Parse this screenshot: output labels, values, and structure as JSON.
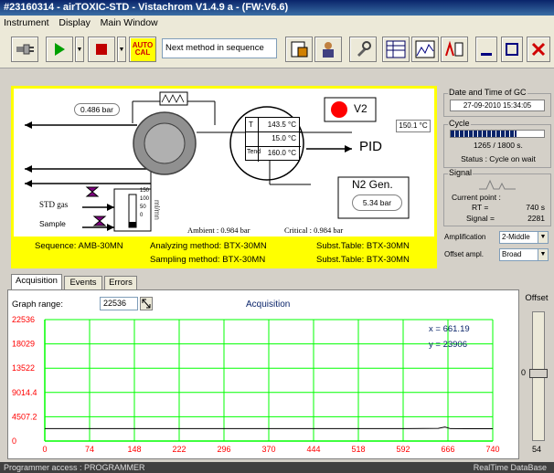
{
  "window": {
    "title": "#23160314 - airTOXIC-STD - Vistachrom V1.4.9 a - (FW:V6.6)"
  },
  "menu": [
    {
      "label": "Instrument"
    },
    {
      "label": "Display"
    },
    {
      "label": "Main Window"
    }
  ],
  "toolbar": {
    "autocal_label": "AUTO\nCAL",
    "method_value": "Next method in sequence"
  },
  "diagram": {
    "pressure_top": "0.486 bar",
    "v2_label": "V2",
    "temp_t_label": "T",
    "temp_t_value": "143.5 °C",
    "temp_2_value": "15.0 °C",
    "temp_tend_label": "Tend",
    "temp_tend_value": "160.0 °C",
    "pid_temp": "150.1 °C",
    "pid_label": "PID",
    "n2_label": "N2 Gen.",
    "n2_value": "5.34 bar",
    "std_gas_label": "STD gas",
    "sample_label": "Sample",
    "flow_unit": "ml/mn",
    "flow_scale": [
      "150",
      "100",
      "50",
      "0"
    ],
    "ambient_text": "Ambient : 0.984 bar",
    "critical_text": "Critical : 0.984 bar"
  },
  "info": {
    "sequence": "Sequence: AMB-30MN",
    "analyzing": "Analyzing method: BTX-30MN",
    "subst_1": "Subst.Table: BTX-30MN",
    "sampling": "Sampling method: BTX-30MN",
    "subst_2": "Subst.Table: BTX-30MN"
  },
  "right_panel": {
    "date_title": "Date and Time of GC",
    "date_value": "27-09-2010 15:34:05",
    "cycle_title": "Cycle",
    "cycle_value": "1265 / 1800 s.",
    "cycle_progress": 0.703,
    "status_text": "Status : Cycle on wait",
    "signal_title": "Signal",
    "current_point_label": "Current point :",
    "rt_label": "RT =",
    "rt_value": "740 s",
    "signal_label": "Signal =",
    "signal_value": "2281",
    "amplification_label": "Amplification",
    "amplification_value": "2-Middle",
    "offset_ampl_label": "Offset ampl.",
    "offset_ampl_value": "Broad"
  },
  "tabs": [
    {
      "label": "Acquisition"
    },
    {
      "label": "Events"
    },
    {
      "label": "Errors"
    }
  ],
  "acquisition": {
    "graph_range_label": "Graph range:",
    "graph_range_value": "22536",
    "title": "Acquisition",
    "cursor_x": "x = 661.19",
    "cursor_y": "y = 23906"
  },
  "offset_panel": {
    "title": "Offset",
    "value": "0",
    "bottom_value": "54"
  },
  "status": {
    "left": "Programmer access : PROGRAMMER",
    "right": "RealTime DataBase"
  },
  "colors": {
    "panel_yellow": "#ffff00",
    "grid_green": "#00ff00",
    "axis_red": "#ff0000",
    "title_blue": "#0a246a"
  },
  "chart_data": {
    "type": "line",
    "title": "Acquisition",
    "xlim": [
      0,
      740
    ],
    "ylim": [
      0,
      22536
    ],
    "x_ticks": [
      "0",
      "74",
      "148",
      "222",
      "296",
      "370",
      "444",
      "518",
      "592",
      "666",
      "740"
    ],
    "y_ticks": [
      "22536",
      "18029",
      "13522",
      "9014.4",
      "4507.2",
      "0"
    ],
    "grid": true,
    "series": [
      {
        "x": [
          0,
          100,
          200,
          300,
          400,
          500,
          600,
          650,
          661,
          670,
          740
        ],
        "y": [
          2300,
          2300,
          2300,
          2310,
          2300,
          2300,
          2310,
          2350,
          2600,
          2300,
          2280
        ]
      }
    ]
  }
}
